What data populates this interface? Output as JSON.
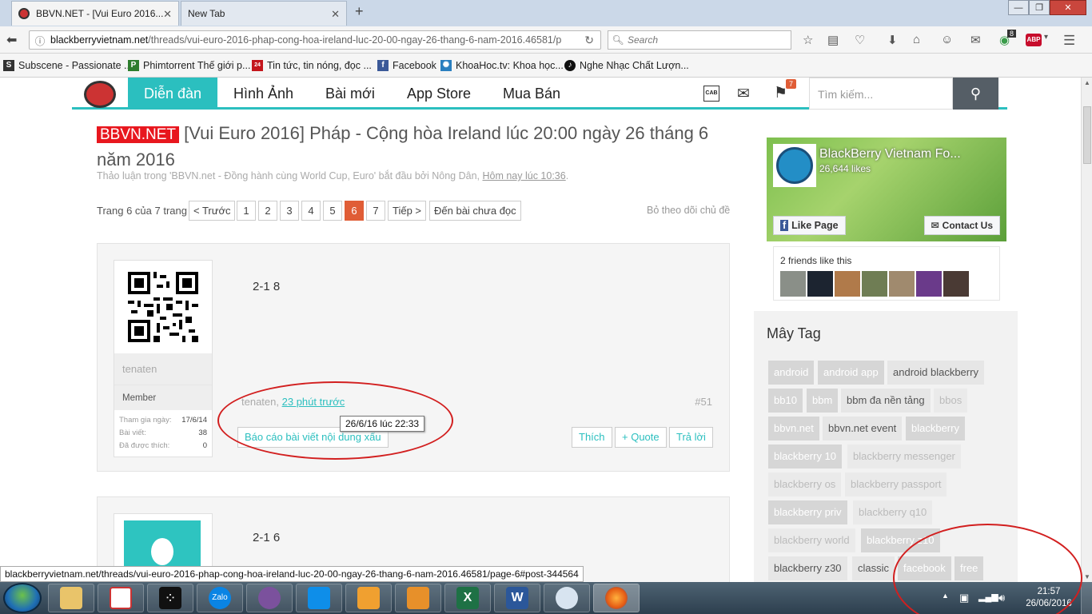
{
  "browser": {
    "tabs": [
      {
        "label": "BBVN.NET - [Vui Euro 2016..."
      },
      {
        "label": "New Tab"
      }
    ],
    "url_domain": "blackberryvietnam.net",
    "url_path": "/threads/vui-euro-2016-phap-cong-hoa-ireland-luc-20-00-ngay-26-thang-6-nam-2016.46581/p",
    "search_placeholder": "Search",
    "badge_count": "8",
    "abp": "ABP",
    "bookmarks": [
      {
        "label": "Subscene - Passionate ...",
        "icon": "S",
        "color": "#333333"
      },
      {
        "label": "Phimtorrent Thế giới p...",
        "icon": "P",
        "color": "#2d7d2d"
      },
      {
        "label": "Tin tức, tin nóng, đọc ...",
        "icon": "24",
        "color": "#c4161c"
      },
      {
        "label": "Facebook",
        "icon": "f",
        "color": "#3b5998"
      },
      {
        "label": "KhoaHoc.tv: Khoa học...",
        "icon": "✺",
        "color": "#2a7fbf"
      },
      {
        "label": "Nghe Nhạc Chất Lượn...",
        "icon": "♪",
        "color": "#111111"
      }
    ]
  },
  "site": {
    "nav": [
      "Diễn đàn",
      "Hình Ảnh",
      "Bài mới",
      "App Store",
      "Mua Bán"
    ],
    "search_placeholder": "Tìm kiếm...",
    "flag_badge": "7",
    "cab_label": "CAB"
  },
  "thread": {
    "prefix": "BBVN.NET",
    "title": "[Vui Euro 2016] Pháp - Cộng hòa Ireland lúc 20:00 ngày 26 tháng 6 năm 2016",
    "desc_prefix": "Thảo luận trong 'BBVN.net - Đồng hành cùng World Cup, Euro' bắt đầu bởi Nông Dân,",
    "desc_date": "Hôm nay lúc 10:36",
    "desc_end": ".",
    "page_label": "Trang 6 của 7 trang",
    "prev": "< Trước",
    "pages": [
      "1",
      "2",
      "3",
      "4",
      "5",
      "6",
      "7"
    ],
    "current_page": "6",
    "next": "Tiếp >",
    "unread": "Đến bài chưa đọc",
    "unfollow": "Bỏ theo dõi chủ đề"
  },
  "posts": [
    {
      "message": "2-1 8",
      "username": "tenaten",
      "user_title": "Member",
      "stats": [
        {
          "k": "Tham gia ngày:",
          "v": "17/6/14"
        },
        {
          "k": "Bài viết:",
          "v": "38"
        },
        {
          "k": "Đã được thích:",
          "v": "0"
        }
      ],
      "meta_user": "tenaten,",
      "meta_time": "23 phút trước",
      "number": "#51",
      "report": "Báo cáo bài viết nội dung xấu",
      "like": "Thích",
      "quote": "+ Quote",
      "reply": "Trả lời",
      "tooltip": "26/6/16 lúc 22:33"
    },
    {
      "message": "2-1 6"
    }
  ],
  "sidebar": {
    "fb_name": "BlackBerry Vietnam Fo...",
    "fb_likes": "26,644 likes",
    "fb_like_btn": "Like Page",
    "fb_contact_btn": "Contact Us",
    "fb_friends": "2 friends like this",
    "tag_title": "Mây Tag",
    "tags": [
      "android",
      "android app",
      "android blackberry",
      "bb10",
      "bbm",
      "bbm đa nền tảng",
      "bbos",
      "bbvn.net",
      "bbvn.net event",
      "blackberry",
      "blackberry 10",
      "blackberry messenger",
      "blackberry os",
      "blackberry passport",
      "blackberry priv",
      "blackberry q10",
      "blackberry world",
      "blackberry z10",
      "blackberry z30",
      "classic",
      "facebook",
      "free"
    ]
  },
  "status_url": "blackberryvietnam.net/threads/vui-euro-2016-phap-cong-hoa-ireland-luc-20-00-ngay-26-thang-6-nam-2016.46581/page-6#post-344564",
  "taskbar": {
    "time": "21:57",
    "date": "26/06/2016",
    "zalo": "Zalo"
  }
}
